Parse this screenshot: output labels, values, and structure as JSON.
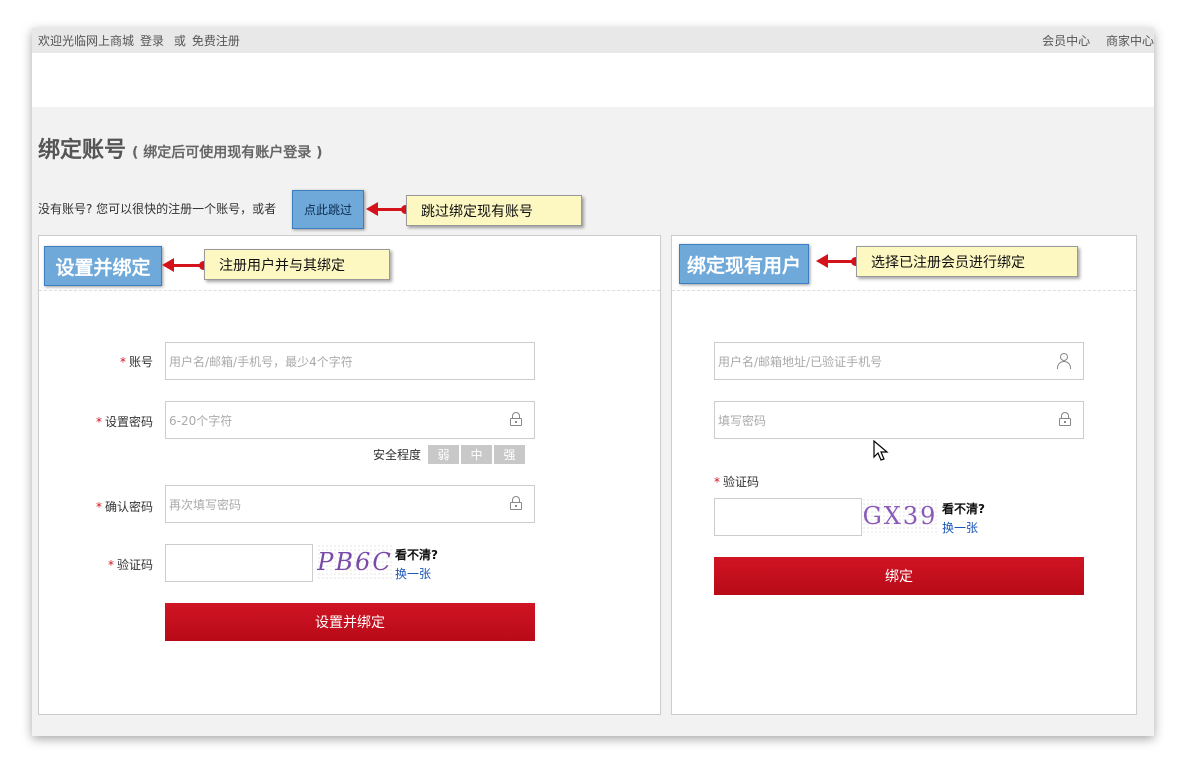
{
  "topbar": {
    "welcome": "欢迎光临网上商城",
    "login": "登录",
    "or": "或",
    "register": "免费注册",
    "member_center": "会员中心",
    "merchant_center": "商家中心"
  },
  "page": {
    "title": "绑定账号",
    "subtitle": "( 绑定后可使用现有账户登录 )",
    "hint": "没有账号? 您可以很快的注册一个账号，或者",
    "skip_button": "点此跳过",
    "skip_callout": "跳过绑定现有账号"
  },
  "left_panel": {
    "title": "设置并绑定",
    "callout": "注册用户并与其绑定",
    "account_label": "账号",
    "account_placeholder": "用户名/邮箱/手机号，最少4个字符",
    "password_label": "设置密码",
    "password_placeholder": "6-20个字符",
    "strength_label": "安全程度",
    "strength_levels": [
      "弱",
      "中",
      "强"
    ],
    "confirm_label": "确认密码",
    "confirm_placeholder": "再次填写密码",
    "captcha_label": "验证码",
    "captcha_text": "PB6C",
    "cant_see": "看不清?",
    "refresh": "换一张",
    "submit": "设置并绑定"
  },
  "right_panel": {
    "title": "绑定现有用户",
    "callout": "选择已注册会员进行绑定",
    "username_placeholder": "用户名/邮箱地址/已验证手机号",
    "password_placeholder": "填写密码",
    "captcha_label": "验证码",
    "captcha_text": "GX39",
    "cant_see": "看不清?",
    "refresh": "换一张",
    "submit": "绑定"
  },
  "colors": {
    "accent_red": "#c40e1c",
    "highlight_blue": "#6fa9d9",
    "callout_yellow": "#fdf8c2",
    "link_blue": "#1a56b5"
  }
}
